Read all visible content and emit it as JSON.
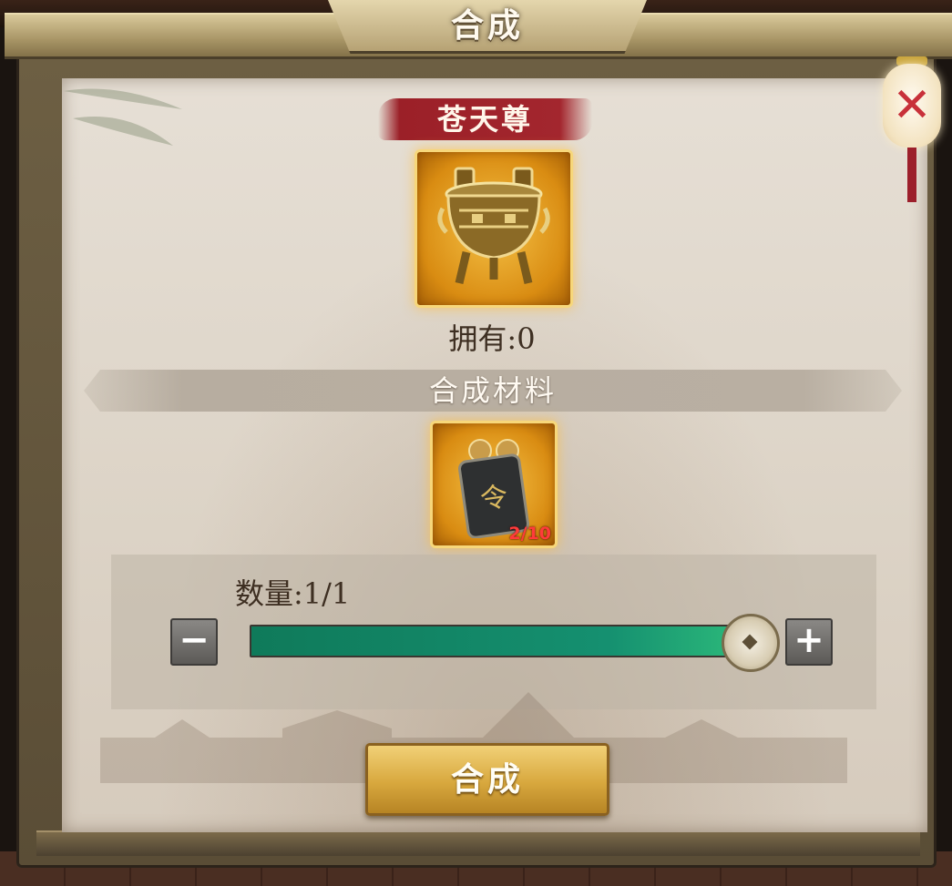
{
  "window": {
    "title": "合成"
  },
  "item": {
    "name": "苍天尊",
    "icon": "bronze-tripod-icon",
    "owned_text": "拥有:0"
  },
  "materials": {
    "section_title": "合成材料",
    "items": [
      {
        "icon": "jade-token-icon",
        "count_text": "2/10",
        "count_color": "#ff3b3b"
      }
    ]
  },
  "quantity": {
    "label": "数量:1/1",
    "current": 1,
    "max": 1,
    "minus_label": "−",
    "plus_label": "+"
  },
  "actions": {
    "synthesize_label": "合成"
  },
  "colors": {
    "slider_fill": "#159070",
    "name_banner": "#a3262e",
    "button_gold": "#d8a83e"
  }
}
